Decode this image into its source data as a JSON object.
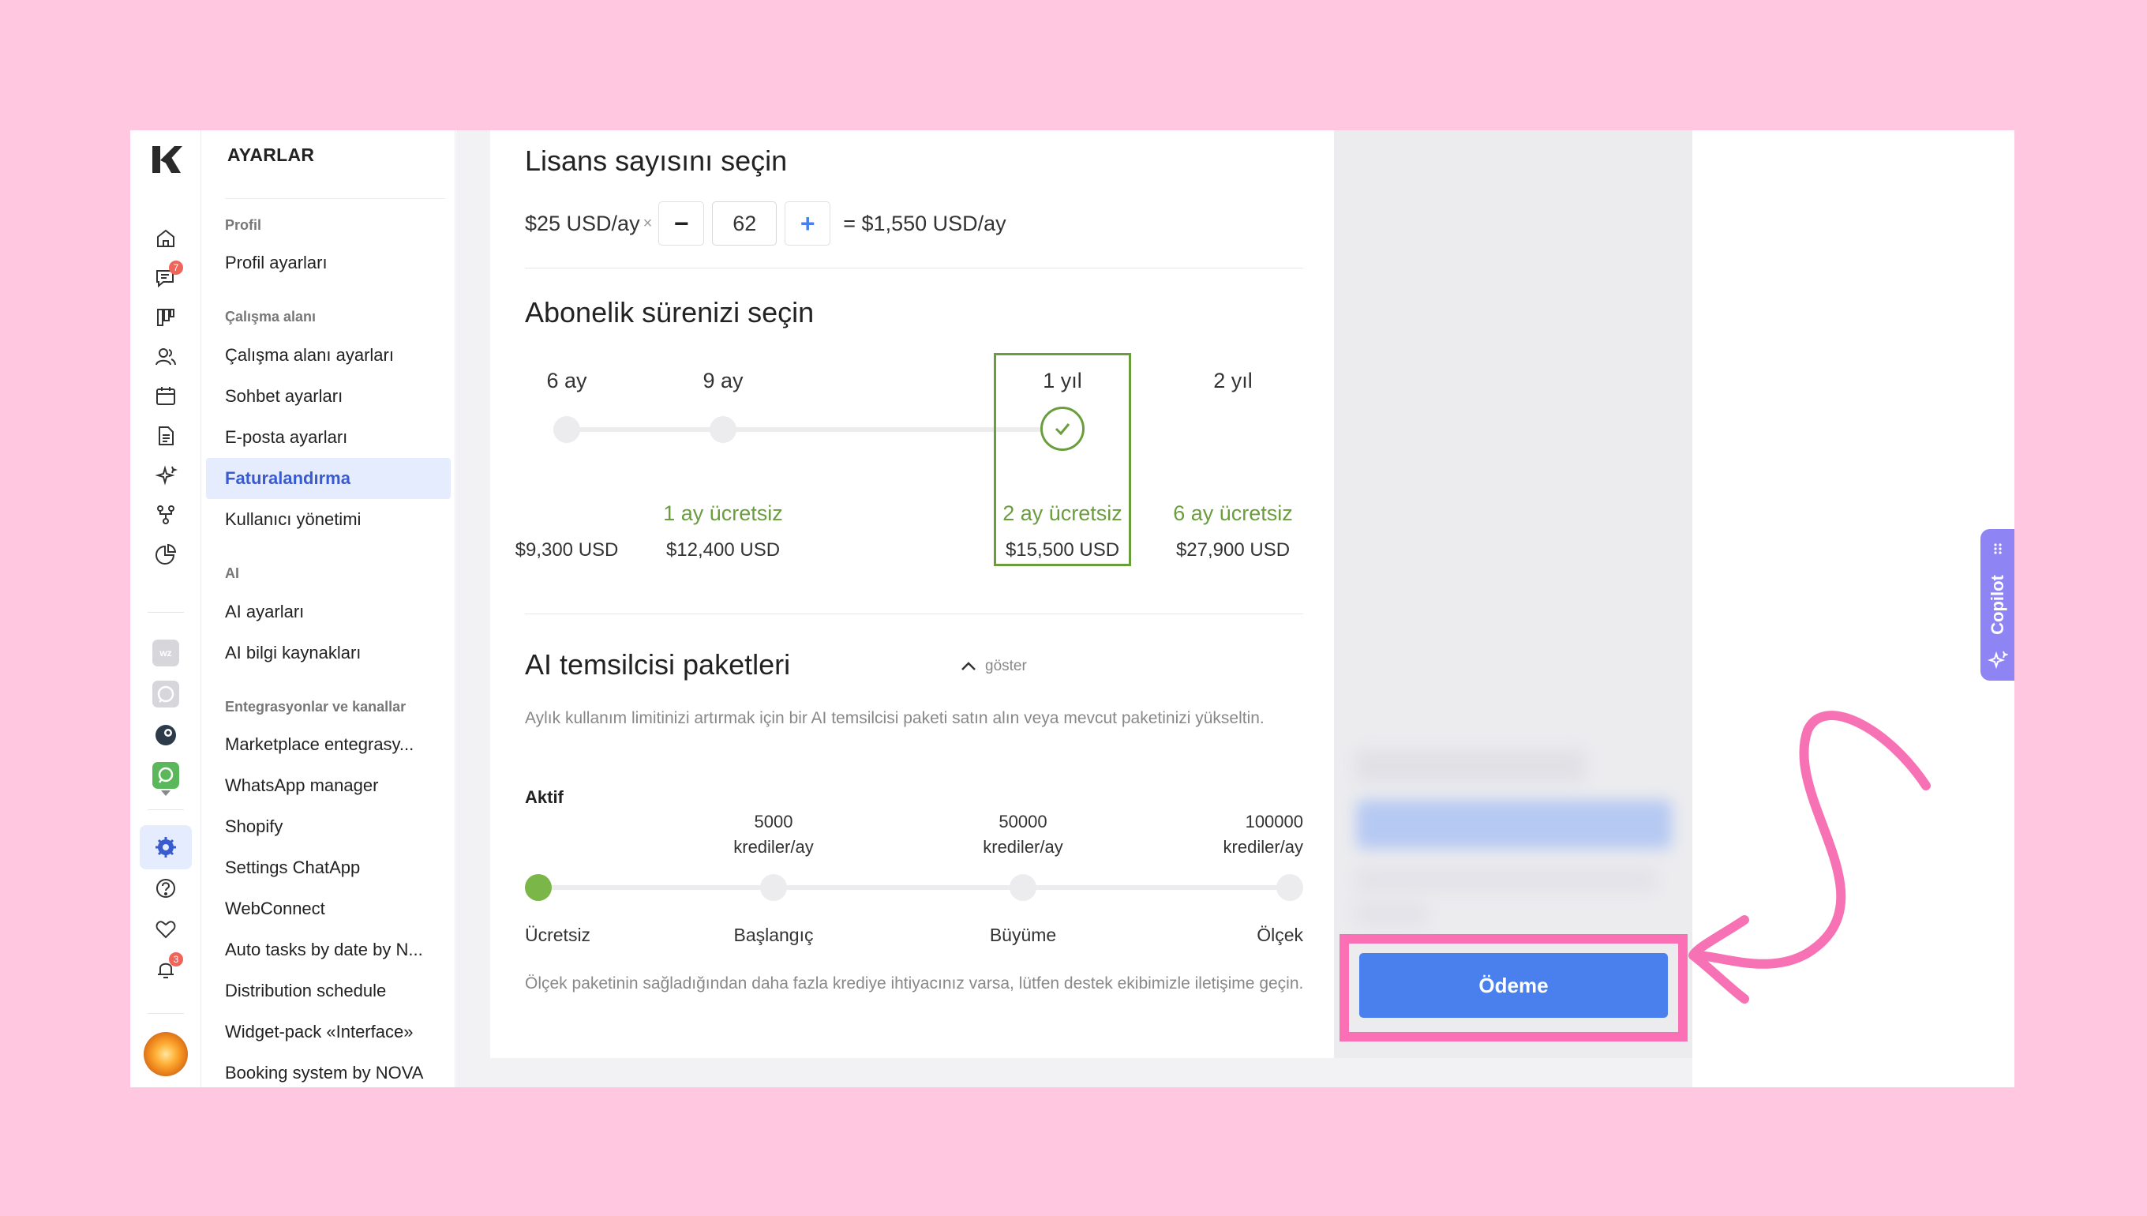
{
  "settings": {
    "title": "AYARLAR",
    "sections": {
      "profile": "Profil",
      "workspace": "Çalışma alanı",
      "ai": "AI",
      "integrations": "Entegrasyonlar ve kanallar"
    },
    "items": {
      "profile_settings": "Profil ayarları",
      "workspace_settings": "Çalışma alanı ayarları",
      "chat_settings": "Sohbet ayarları",
      "email_settings": "E-posta ayarları",
      "billing": "Faturalandırma",
      "user_management": "Kullanıcı yönetimi",
      "ai_settings": "AI ayarları",
      "ai_knowledge": "AI bilgi kaynakları",
      "marketplace": "Marketplace entegrasy...",
      "whatsapp_manager": "WhatsApp manager",
      "shopify": "Shopify",
      "settings_chatapp": "Settings ChatApp",
      "webconnect": "WebConnect",
      "auto_tasks": "Auto tasks by date by N...",
      "distribution": "Distribution schedule",
      "widget_pack": "Widget-pack «Interface»",
      "booking": "Booking system by NOVA"
    }
  },
  "rail": {
    "chat_badge": "7",
    "notify_badge": "3",
    "wz_label": "wz"
  },
  "license": {
    "title": "Lisans sayısını seçin",
    "unit_price": "$25 USD/ay",
    "times": "×",
    "minus": "−",
    "count": "62",
    "plus": "+",
    "total": "= $1,550 USD/ay"
  },
  "subscription": {
    "title": "Abonelik sürenizi seçin",
    "options": [
      {
        "label": "6 ay",
        "free": "",
        "price": "$9,300 USD"
      },
      {
        "label": "9 ay",
        "free": "1 ay ücretsiz",
        "price": "$12,400 USD"
      },
      {
        "label": "1 yıl",
        "free": "2 ay ücretsiz",
        "price": "$15,500 USD"
      },
      {
        "label": "2 yıl",
        "free": "6 ay ücretsiz",
        "price": "$27,900 USD"
      }
    ],
    "selected_index": 2
  },
  "ai_packages": {
    "title": "AI temsilcisi paketleri",
    "toggle": "göster",
    "description": "Aylık kullanım limitinizi artırmak için bir AI temsilcisi paketi satın alın veya mevcut paketinizi yükseltin.",
    "active_label": "Aktif",
    "tiers": [
      {
        "credits": "",
        "unit": "",
        "name": "Ücretsiz"
      },
      {
        "credits": "5000",
        "unit": "krediler/ay",
        "name": "Başlangıç"
      },
      {
        "credits": "50000",
        "unit": "krediler/ay",
        "name": "Büyüme"
      },
      {
        "credits": "100000",
        "unit": "krediler/ay",
        "name": "Ölçek"
      }
    ],
    "footnote": "Ölçek paketinin sağladığından daha fazla krediye ihtiyacınız varsa, lütfen destek ekibimizle iletişime geçin."
  },
  "summary": {
    "pay_button": "Ödeme"
  },
  "copilot": {
    "label": "Copilot"
  },
  "colors": {
    "accent_blue": "#4a80ee",
    "selected_green": "#6a9e3c",
    "highlight_pink": "#fb6fb4",
    "copilot_purple": "#8f84f3"
  }
}
